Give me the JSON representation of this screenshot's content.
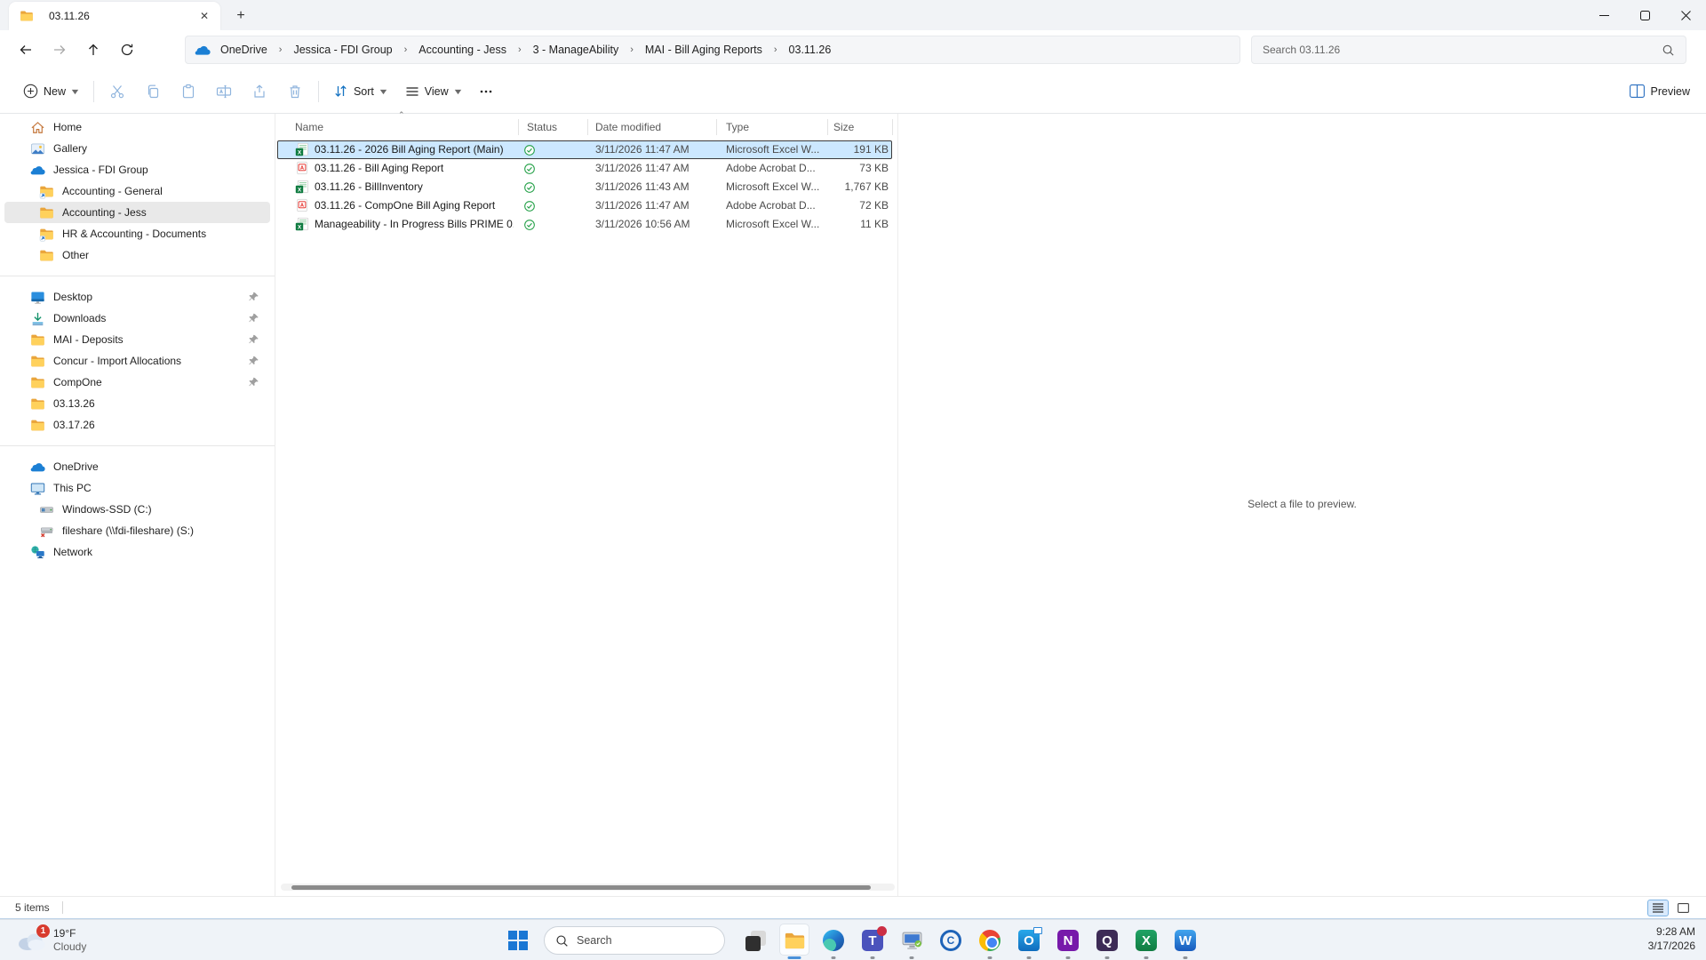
{
  "window": {
    "tab_title": "03.11.26",
    "controls": [
      "minimize",
      "maximize",
      "close"
    ]
  },
  "address_bar": {
    "breadcrumbs": [
      "OneDrive",
      "Jessica - FDI Group",
      "Accounting - Jess",
      "3 - ManageAbility",
      "MAI - Bill Aging Reports",
      "03.11.26"
    ],
    "search_placeholder": "Search 03.11.26"
  },
  "toolbar": {
    "new_label": "New",
    "sort_label": "Sort",
    "view_label": "View",
    "preview_label": "Preview"
  },
  "sidebar": {
    "sections": [
      {
        "items": [
          {
            "label": "Home",
            "icon": "home"
          },
          {
            "label": "Gallery",
            "icon": "gallery"
          },
          {
            "label": "Jessica - FDI Group",
            "icon": "onedrive"
          },
          {
            "label": "Accounting - General",
            "icon": "folder-link",
            "indent": 1
          },
          {
            "label": "Accounting - Jess",
            "icon": "folder",
            "indent": 1,
            "selected": true
          },
          {
            "label": "HR & Accounting - Documents",
            "icon": "folder-link",
            "indent": 1
          },
          {
            "label": "Other",
            "icon": "folder",
            "indent": 1
          }
        ]
      },
      {
        "items": [
          {
            "label": "Desktop",
            "icon": "desktop",
            "pinned": true
          },
          {
            "label": "Downloads",
            "icon": "downloads",
            "pinned": true
          },
          {
            "label": "MAI - Deposits",
            "icon": "folder",
            "pinned": true
          },
          {
            "label": "Concur - Import Allocations",
            "icon": "folder",
            "pinned": true
          },
          {
            "label": "CompOne",
            "icon": "folder",
            "pinned": true
          },
          {
            "label": "03.13.26",
            "icon": "folder"
          },
          {
            "label": "03.17.26",
            "icon": "folder"
          }
        ]
      },
      {
        "items": [
          {
            "label": "OneDrive",
            "icon": "onedrive"
          },
          {
            "label": "This PC",
            "icon": "pc"
          },
          {
            "label": "Windows-SSD (C:)",
            "icon": "drive",
            "indent": 1
          },
          {
            "label": "fileshare (\\\\fdi-fileshare) (S:)",
            "icon": "netdrive",
            "indent": 1
          },
          {
            "label": "Network",
            "icon": "network"
          }
        ]
      }
    ]
  },
  "file_list": {
    "columns": [
      "Name",
      "Status",
      "Date modified",
      "Type",
      "Size"
    ],
    "sort": {
      "column": "Name",
      "direction": "ascending"
    },
    "rows": [
      {
        "name": "03.11.26 - 2026 Bill Aging Report (Main)",
        "icon": "excel",
        "status": "synced",
        "modified": "3/11/2026 11:47 AM",
        "type": "Microsoft Excel W...",
        "size": "191 KB",
        "selected": true
      },
      {
        "name": "03.11.26 - Bill Aging Report",
        "icon": "pdf",
        "status": "synced",
        "modified": "3/11/2026 11:47 AM",
        "type": "Adobe Acrobat D...",
        "size": "73 KB"
      },
      {
        "name": "03.11.26 - BillInventory",
        "icon": "excel",
        "status": "synced",
        "modified": "3/11/2026 11:43 AM",
        "type": "Microsoft Excel W...",
        "size": "1,767 KB"
      },
      {
        "name": "03.11.26 - CompOne Bill Aging Report",
        "icon": "pdf",
        "status": "synced",
        "modified": "3/11/2026 11:47 AM",
        "type": "Adobe Acrobat D...",
        "size": "72 KB"
      },
      {
        "name": "Manageability - In Progress Bills PRIME 0...",
        "icon": "excel",
        "status": "synced",
        "modified": "3/11/2026 10:56 AM",
        "type": "Microsoft Excel W...",
        "size": "11 KB"
      }
    ]
  },
  "preview_pane": {
    "message": "Select a file to preview."
  },
  "status_bar": {
    "items_count": "5 items"
  },
  "taskbar": {
    "weather": {
      "temp": "19°F",
      "condition": "Cloudy",
      "badge": "1"
    },
    "search_placeholder": "Search",
    "apps": [
      {
        "name": "task-view",
        "running": false
      },
      {
        "name": "file-explorer",
        "running": true,
        "active": true
      },
      {
        "name": "edge",
        "running": true
      },
      {
        "name": "teams",
        "running": true,
        "badge": true
      },
      {
        "name": "remote-desktop",
        "running": true
      },
      {
        "name": "concur",
        "running": false
      },
      {
        "name": "chrome",
        "running": true
      },
      {
        "name": "outlook",
        "running": true
      },
      {
        "name": "onenote",
        "running": true
      },
      {
        "name": "q-app",
        "running": true
      },
      {
        "name": "excel",
        "running": true
      },
      {
        "name": "word",
        "running": true
      }
    ],
    "clock": {
      "time": "9:28 AM",
      "date": "3/17/2026"
    }
  },
  "colors": {
    "selection_blue": "#cce8ff",
    "sync_green": "#23a047",
    "accent_blue": "#1a77d4"
  }
}
